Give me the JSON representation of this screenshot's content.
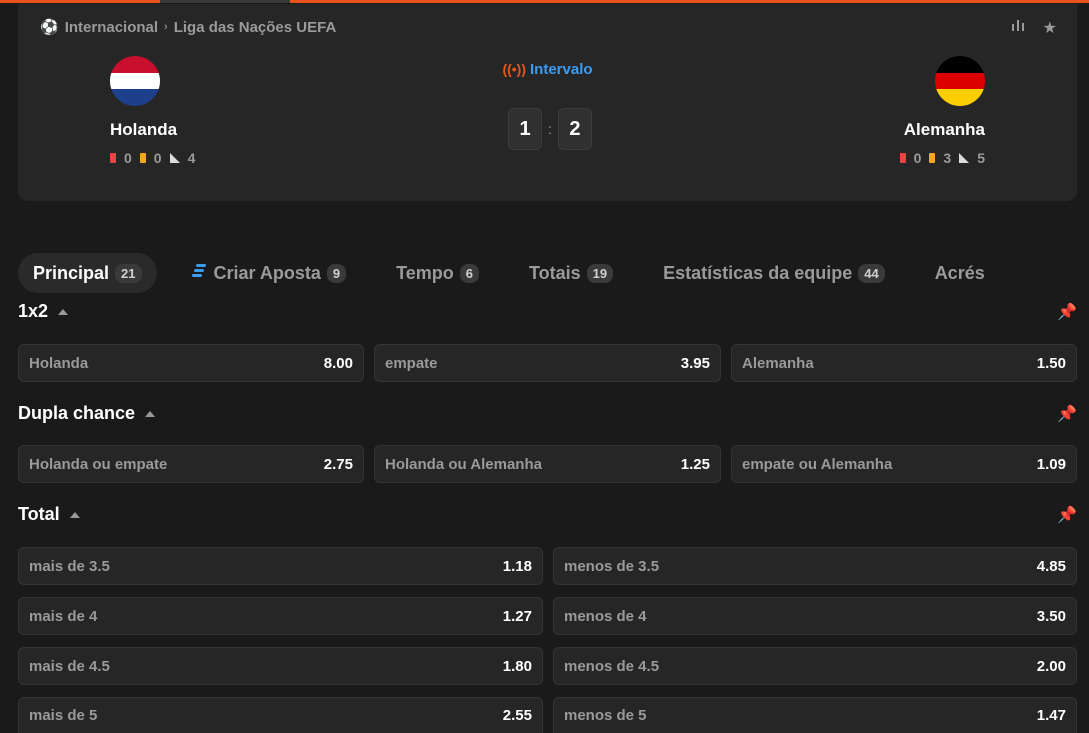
{
  "match": {
    "breadcrumb": [
      "Internacional",
      "Liga das Nações UEFA"
    ],
    "status": "Intervalo",
    "home": {
      "name": "Holanda",
      "red": "0",
      "yellow": "0",
      "corners": "4"
    },
    "away": {
      "name": "Alemanha",
      "red": "0",
      "yellow": "3",
      "corners": "5"
    },
    "score": {
      "home": "1",
      "away": "2",
      "separator": ":"
    },
    "icons": [
      "stats-icon",
      "star-icon",
      "soccer-ball-icon",
      "live-icon"
    ]
  },
  "tabs": [
    {
      "label": "Principal",
      "count": "21"
    },
    {
      "label": "Criar Aposta",
      "count": "9"
    },
    {
      "label": "Tempo",
      "count": "6"
    },
    {
      "label": "Totais",
      "count": "19"
    },
    {
      "label": "Estatísticas da equipe",
      "count": "44"
    },
    {
      "label": "Acrés",
      "count": ""
    }
  ],
  "sections": {
    "x12": {
      "title": "1x2",
      "odds": [
        {
          "label": "Holanda",
          "value": "8.00"
        },
        {
          "label": "empate",
          "value": "3.95"
        },
        {
          "label": "Alemanha",
          "value": "1.50"
        }
      ]
    },
    "double": {
      "title": "Dupla chance",
      "odds": [
        {
          "label": "Holanda ou empate",
          "value": "2.75"
        },
        {
          "label": "Holanda ou Alemanha",
          "value": "1.25"
        },
        {
          "label": "empate ou Alemanha",
          "value": "1.09"
        }
      ]
    },
    "total": {
      "title": "Total",
      "rows": [
        [
          {
            "label": "mais de 3.5",
            "value": "1.18"
          },
          {
            "label": "menos de 3.5",
            "value": "4.85"
          }
        ],
        [
          {
            "label": "mais de 4",
            "value": "1.27"
          },
          {
            "label": "menos de 4",
            "value": "3.50"
          }
        ],
        [
          {
            "label": "mais de 4.5",
            "value": "1.80"
          },
          {
            "label": "menos de 4.5",
            "value": "2.00"
          }
        ],
        [
          {
            "label": "mais de 5",
            "value": "2.55"
          },
          {
            "label": "menos de 5",
            "value": "1.47"
          }
        ]
      ]
    }
  },
  "colors": {
    "accent": "#e8541c",
    "live_blue": "#3b9cf0",
    "red_card": "#ef4444",
    "yellow_card": "#f5a623"
  }
}
